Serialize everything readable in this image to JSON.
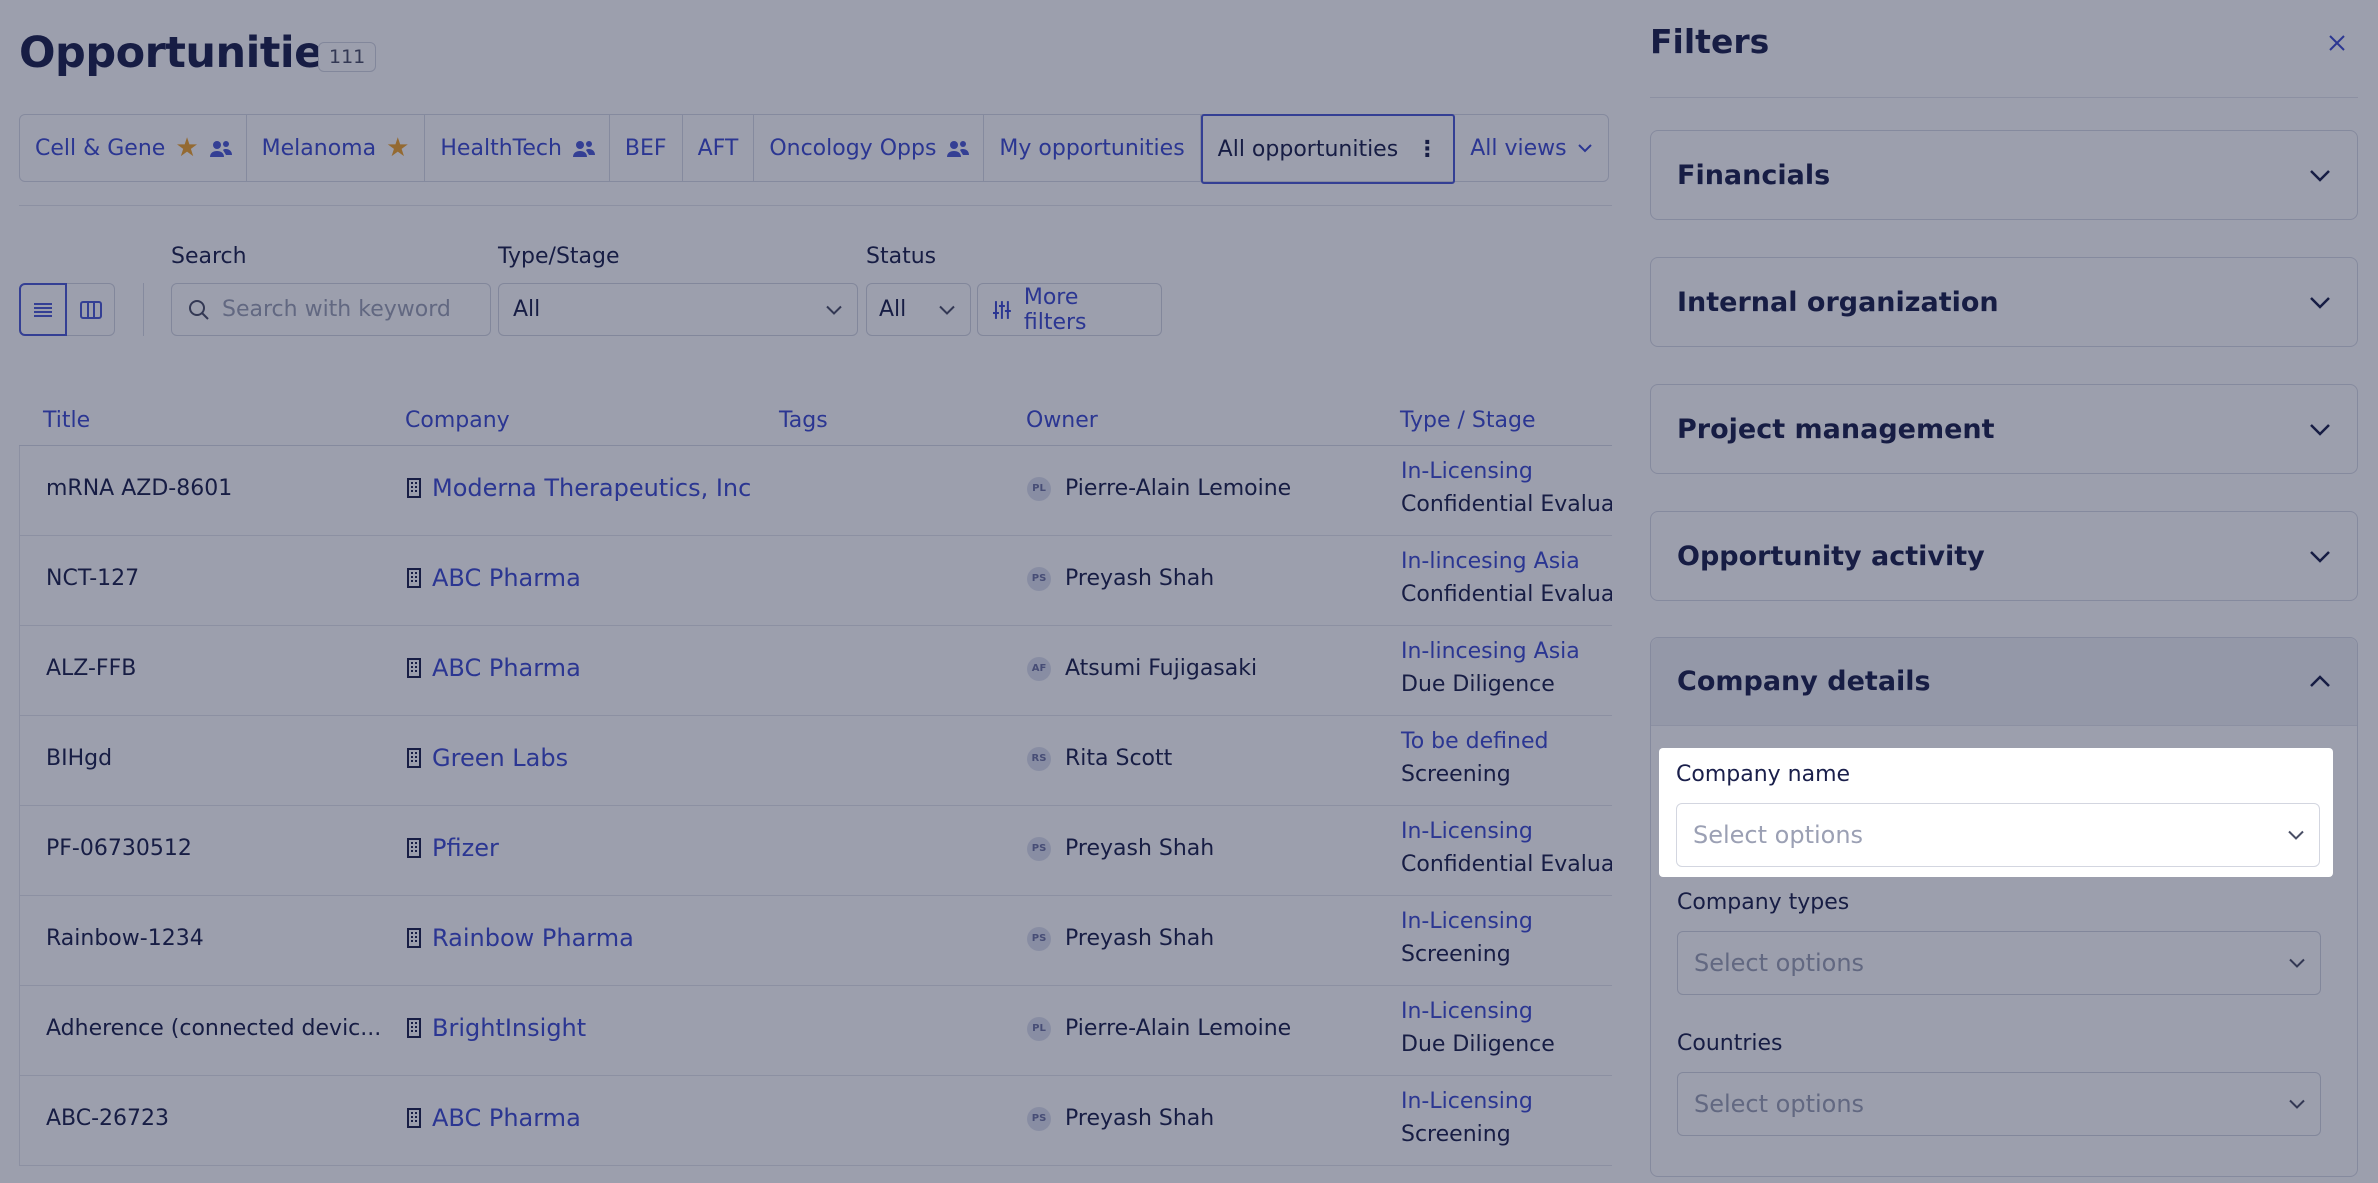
{
  "page": {
    "title": "Opportunities",
    "count": "111"
  },
  "tabs": [
    {
      "label": "Cell & Gene",
      "star": true,
      "shared": true
    },
    {
      "label": "Melanoma",
      "star": true,
      "shared": false
    },
    {
      "label": "HealthTech",
      "star": false,
      "shared": true
    },
    {
      "label": "BEF",
      "star": false,
      "shared": false
    },
    {
      "label": "AFT",
      "star": false,
      "shared": false
    },
    {
      "label": "Oncology Opps",
      "star": false,
      "shared": true
    },
    {
      "label": "My opportunities",
      "star": false,
      "shared": false
    },
    {
      "label": "All opportunities",
      "star": false,
      "shared": false,
      "active": true
    },
    {
      "label": "All views",
      "star": false,
      "shared": false
    }
  ],
  "toolbar": {
    "search_label": "Search",
    "search_placeholder": "Search with keyword",
    "type_label": "Type/Stage",
    "type_value": "All",
    "status_label": "Status",
    "status_value": "All",
    "more_filters": "More filters"
  },
  "table": {
    "headers": [
      "Title",
      "Company",
      "Tags",
      "Owner",
      "Type / Stage"
    ],
    "rows": [
      {
        "title": "mRNA AZD-8601",
        "company": "Moderna Therapeutics, Inc",
        "initials": "PL",
        "owner": "Pierre-Alain Lemoine",
        "type": "In-Licensing",
        "stage": "Confidential Evaluat"
      },
      {
        "title": "NCT-127",
        "company": "ABC Pharma",
        "initials": "PS",
        "owner": "Preyash Shah",
        "type": "In-lincesing Asia",
        "stage": "Confidential Evaluat"
      },
      {
        "title": "ALZ-FFB",
        "company": "ABC Pharma",
        "initials": "AF",
        "owner": "Atsumi Fujigasaki",
        "type": "In-lincesing Asia",
        "stage": "Due Diligence"
      },
      {
        "title": "BIHgd",
        "company": "Green Labs",
        "initials": "RS",
        "owner": "Rita Scott",
        "type": "To be defined",
        "stage": "Screening"
      },
      {
        "title": "PF-06730512",
        "company": "Pfizer",
        "initials": "PS",
        "owner": "Preyash Shah",
        "type": "In-Licensing",
        "stage": "Confidential Evaluat"
      },
      {
        "title": "Rainbow-1234",
        "company": "Rainbow Pharma",
        "initials": "PS",
        "owner": "Preyash Shah",
        "type": "In-Licensing",
        "stage": "Screening"
      },
      {
        "title": "Adherence (connected devic...",
        "company": "BrightInsight",
        "initials": "PL",
        "owner": "Pierre-Alain Lemoine",
        "type": "In-Licensing",
        "stage": "Due Diligence"
      },
      {
        "title": "ABC-26723",
        "company": "ABC Pharma",
        "initials": "PS",
        "owner": "Preyash Shah",
        "type": "In-Licensing",
        "stage": "Screening"
      }
    ]
  },
  "filters": {
    "title": "Filters",
    "sections": [
      {
        "label": "Financials"
      },
      {
        "label": "Internal organization"
      },
      {
        "label": "Project management"
      },
      {
        "label": "Opportunity activity"
      },
      {
        "label": "Company details"
      }
    ],
    "company_details": {
      "company_name_label": "Company name",
      "company_types_label": "Company types",
      "countries_label": "Countries",
      "placeholder": "Select options"
    }
  },
  "colors": {
    "accent": "#3d4bd0",
    "star": "#f1a42b",
    "text": "#1a1f4b"
  }
}
